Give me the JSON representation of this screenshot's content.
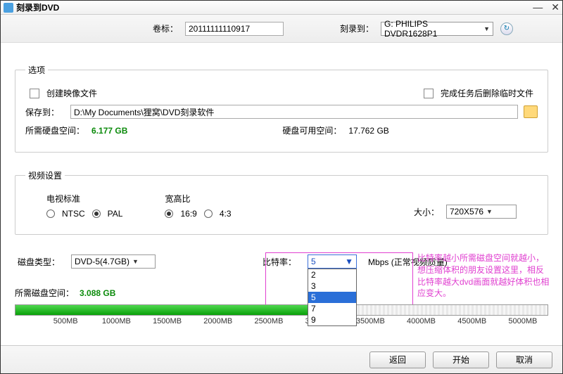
{
  "window": {
    "title": "刻录到DVD"
  },
  "top": {
    "volume_label": "卷标：",
    "volume_value": "20111111110917",
    "burnto_label": "刻录到：",
    "burnto_value": "G: PHILIPS  DVDR1628P1"
  },
  "options": {
    "legend": "选项",
    "create_image": "创建映像文件",
    "delete_temp": "完成任务后删除临时文件",
    "saveto_label": "保存到：",
    "saveto_path": "D:\\My Documents\\狸窝\\DVD刻录软件",
    "req_space_label": "所需硬盘空间：",
    "req_space_value": "6.177 GB",
    "avail_space_label": "硬盘可用空间：",
    "avail_space_value": "17.762 GB"
  },
  "video": {
    "legend": "视频设置",
    "tv_label": "电视标准",
    "ntsc": "NTSC",
    "pal": "PAL",
    "aspect_label": "宽高比",
    "a169": "16:9",
    "a43": "4:3",
    "size_label": "大小：",
    "size_value": "720X576"
  },
  "disc": {
    "type_label": "磁盘类型：",
    "type_value": "DVD-5(4.7GB)",
    "bitrate_label": "比特率：",
    "bitrate_value": "5",
    "bitrate_options": [
      "2",
      "3",
      "5",
      "7",
      "9"
    ],
    "unit_quality": "Mbps (正常视频质量)"
  },
  "annotation": "比特率越小所需磁盘空间就越小，想压缩体积的朋友设置这里，相反比特率越大dvd画面就越好体积也相应变大。",
  "bar": {
    "req_label": "所需磁盘空间：",
    "req_value": "3.088 GB",
    "fill_percent": 58,
    "ticks": [
      "500MB",
      "1000MB",
      "1500MB",
      "2000MB",
      "2500MB",
      "3000MB",
      "3500MB",
      "4000MB",
      "4500MB",
      "5000MB"
    ]
  },
  "footer": {
    "back": "返回",
    "start": "开始",
    "cancel": "取消"
  }
}
